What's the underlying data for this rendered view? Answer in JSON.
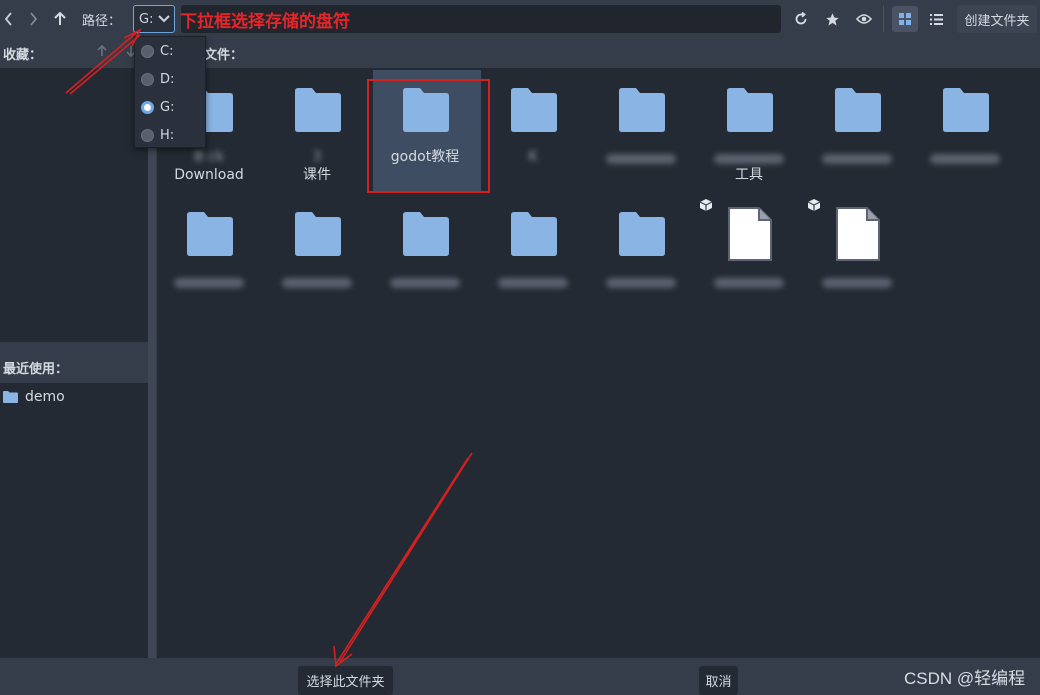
{
  "toolbar": {
    "path_label": "路径：",
    "drive_value": "G:",
    "create_folder_label": "创建文件夹"
  },
  "annotations": {
    "top_text": "下拉框选择存储的盘符"
  },
  "favorites": {
    "header": "收藏："
  },
  "recent": {
    "header": "最近使用：",
    "items": [
      {
        "label": "demo"
      }
    ]
  },
  "files": {
    "header": "文件：",
    "items": [
      {
        "label": "B...ck Download",
        "line1": "B      ck",
        "line2": "Download",
        "type": "folder",
        "blurred": true
      },
      {
        "label": "... 3 课件",
        "line1": "     3",
        "line2": "课件",
        "type": "folder",
        "blurred": true
      },
      {
        "label": "godot教程",
        "line1": "godot教程",
        "line2": "",
        "type": "folder",
        "selected": true
      },
      {
        "label": "K...",
        "line1": "K",
        "line2": "",
        "type": "folder",
        "blurred": true
      },
      {
        "label": "",
        "line1": "",
        "line2": "",
        "type": "folder",
        "blurred": true
      },
      {
        "label": "... 工具",
        "line1": "",
        "line2": "工具",
        "type": "folder",
        "blurred": true
      },
      {
        "label": "...",
        "line1": "",
        "line2": "",
        "type": "folder",
        "blurred": true
      },
      {
        "label": "...",
        "line1": "",
        "line2": "",
        "type": "folder",
        "blurred": true
      },
      {
        "label": "",
        "line1": "",
        "line2": "",
        "type": "folder",
        "blurred": true
      },
      {
        "label": "",
        "line1": "",
        "line2": "",
        "type": "folder",
        "blurred": true
      },
      {
        "label": "",
        "line1": "",
        "line2": "",
        "type": "folder",
        "blurred": true
      },
      {
        "label": "",
        "line1": "",
        "line2": "",
        "type": "folder",
        "blurred": true
      },
      {
        "label": "",
        "line1": "",
        "line2": "",
        "type": "folder",
        "blurred": true
      },
      {
        "label": "",
        "line1": "",
        "line2": "",
        "type": "file",
        "blurred": true
      },
      {
        "label": "",
        "line1": "",
        "line2": "",
        "type": "file",
        "blurred": true
      }
    ]
  },
  "drive_dropdown": {
    "options": [
      {
        "label": "C:",
        "selected": false
      },
      {
        "label": "D:",
        "selected": false
      },
      {
        "label": "G:",
        "selected": true
      },
      {
        "label": "H:",
        "selected": false
      }
    ]
  },
  "bottom": {
    "select_folder_label": "选择此文件夹",
    "cancel_label": "取消"
  },
  "watermark": "CSDN @轻编程",
  "colors": {
    "accent": "#6fa8e8",
    "folder": "#8ab4e4",
    "annotation_red": "#e3262a",
    "panel_bg": "#242a33",
    "chrome_bg": "#363d4a"
  }
}
